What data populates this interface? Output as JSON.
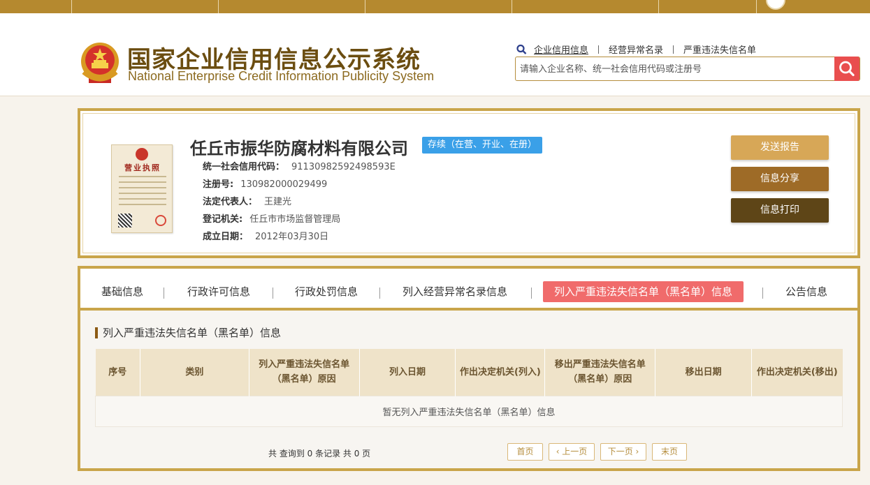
{
  "site": {
    "title_cn": "国家企业信用信息公示系统",
    "title_en": "National Enterprise Credit Information Publicity System"
  },
  "quick_links": [
    "企业信用信息",
    "经营异常名录",
    "严重违法失信名单"
  ],
  "search": {
    "placeholder": "请输入企业名称、统一社会信用代码或注册号"
  },
  "company": {
    "name": "任丘市振华防腐材料有限公司",
    "status": "存续（在营、开业、在册）",
    "license_title": "营业执照",
    "fields": [
      {
        "label": "统一社会信用代码：",
        "value": "91130982592498593E"
      },
      {
        "label": "注册号:",
        "value": "130982000029499"
      },
      {
        "label": "法定代表人：",
        "value": "王建光"
      },
      {
        "label": "登记机关:",
        "value": "任丘市市场监督管理局"
      },
      {
        "label": "成立日期：",
        "value": "2012年03月30日"
      }
    ]
  },
  "actions": {
    "send_report": "发送报告",
    "share": "信息分享",
    "print": "信息打印"
  },
  "tabs": [
    "基础信息",
    "行政许可信息",
    "行政处罚信息",
    "列入经营异常名录信息",
    "列入严重违法失信名单（黑名单）信息",
    "公告信息"
  ],
  "section": {
    "title": "列入严重违法失信名单（黑名单）信息",
    "columns": [
      "序号",
      "类别",
      "列入严重违法失信名单（黑名单）原因",
      "列入日期",
      "作出决定机关(列入)",
      "移出严重违法失信名单（黑名单）原因",
      "移出日期",
      "作出决定机关(移出)"
    ],
    "empty_text": "暂无列入严重违法失信名单（黑名单）信息"
  },
  "pagination": {
    "info": "共 查询到 0 条记录 共 0 页",
    "first": "首页",
    "prev": "‹ 上一页",
    "next": "下一页 ›",
    "last": "末页"
  },
  "colors": {
    "gold": "#c9a54a",
    "brown_dark": "#5e4517",
    "active_tab": "#f06b6b",
    "status_blue": "#3aa0e8",
    "search_red": "#e94e4e"
  }
}
